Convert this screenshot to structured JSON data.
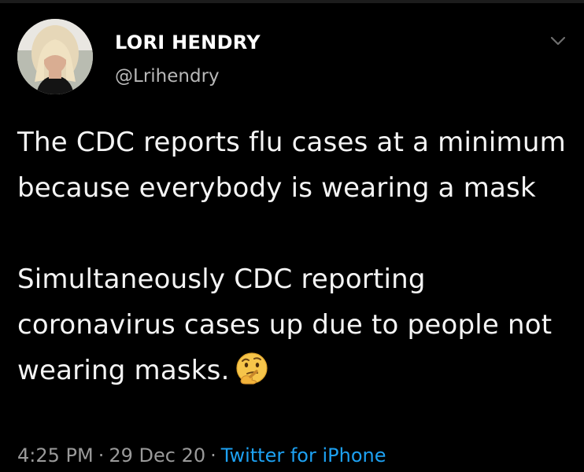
{
  "tweet": {
    "author": {
      "display_name": "LORI HENDRY",
      "handle": "@Lrihendry",
      "avatar_icon": "profile-photo"
    },
    "menu_icon": "chevron-down-icon",
    "paragraphs": [
      "The CDC reports flu cases at a minimum because everybody is wearing a mask",
      "Simultaneously CDC reporting coronavirus cases up due to people not wearing masks."
    ],
    "emoji": "thinking-face-emoji",
    "meta": {
      "time": "4:25 PM",
      "separator": "·",
      "date": "29 Dec 20",
      "source": "Twitter for iPhone"
    }
  },
  "colors": {
    "background": "#000000",
    "text": "#f4f4f4",
    "muted": "#9a9a9a",
    "link": "#1da1f2"
  }
}
